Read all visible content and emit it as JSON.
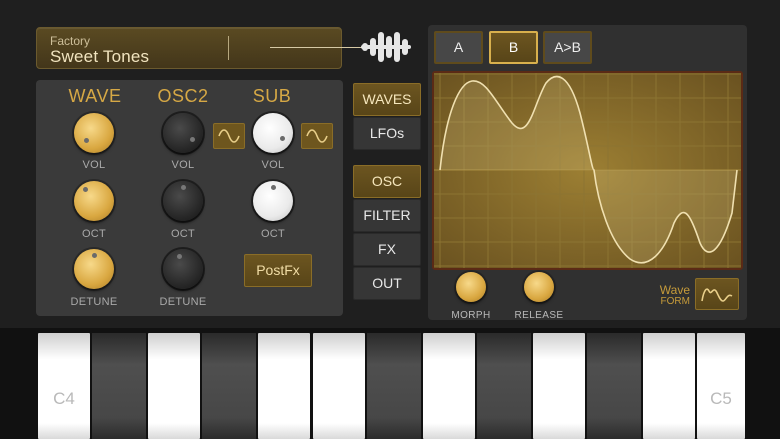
{
  "preset": {
    "category": "Factory",
    "name": "Sweet Tones"
  },
  "osc": {
    "columns": [
      "WAVE",
      "OSC2",
      "SUB"
    ],
    "knob_labels": {
      "vol": "VOL",
      "oct": "OCT",
      "detune": "DETUNE"
    },
    "postfx_label": "PostFx"
  },
  "menu": {
    "waves": "WAVES",
    "lfos": "LFOs",
    "osc": "OSC",
    "filter": "FILTER",
    "fx": "FX",
    "out": "OUT"
  },
  "ab": {
    "a": "A",
    "b": "B",
    "atob": "A>B",
    "selected": "B"
  },
  "scope_controls": {
    "morph": "MORPH",
    "release": "RELEASE",
    "waveform_line1": "Wave",
    "waveform_line2": "FORM"
  },
  "keyboard": {
    "c4": "C4",
    "c5": "C5"
  },
  "colors": {
    "accent": "#d9a740",
    "accent_dark": "#6c5520",
    "panel": "#3a3a3a",
    "background": "#1f1f1f"
  },
  "icons": [
    "logo-waveform-icon",
    "sine-wave-icon",
    "waveform-icon"
  ]
}
